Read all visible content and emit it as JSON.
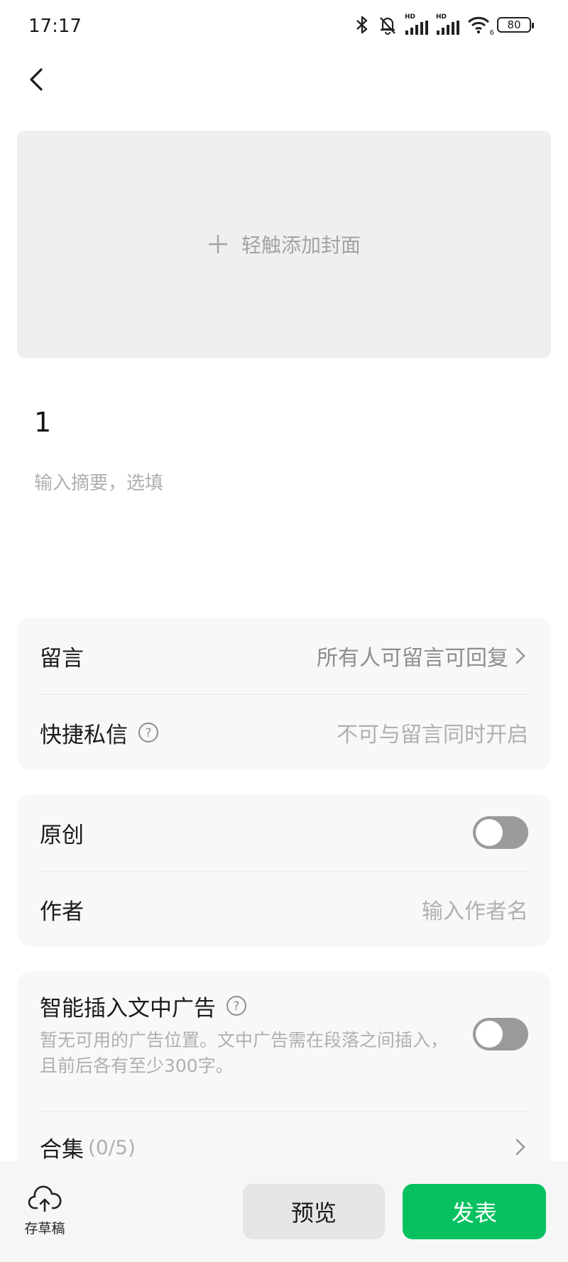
{
  "status_bar": {
    "time": "17:17",
    "battery": "80",
    "wifi_badge": "6",
    "hd_label": "HD"
  },
  "cover": {
    "add_label": "轻触添加封面"
  },
  "article": {
    "title": "1",
    "summary_placeholder": "输入摘要，选填"
  },
  "settings_card_1": {
    "comments": {
      "label": "留言",
      "value": "所有人可留言可回复"
    },
    "quick_message": {
      "label": "快捷私信",
      "value": "不可与留言同时开启"
    }
  },
  "settings_card_2": {
    "original": {
      "label": "原创",
      "enabled": false
    },
    "author": {
      "label": "作者",
      "placeholder": "输入作者名"
    }
  },
  "settings_card_3": {
    "smart_ads": {
      "label": "智能插入文中广告",
      "description": "暂无可用的广告位置。文中广告需在段落之间插入，且前后各有至少300字。",
      "enabled": false
    },
    "collection": {
      "label": "合集",
      "count": "(0/5)"
    }
  },
  "bottom_bar": {
    "draft_label": "存草稿",
    "preview_label": "预览",
    "publish_label": "发表"
  },
  "colors": {
    "accent": "#07c160",
    "toggle_off": "#9a9a9a",
    "card_bg": "#f7f8fa"
  }
}
